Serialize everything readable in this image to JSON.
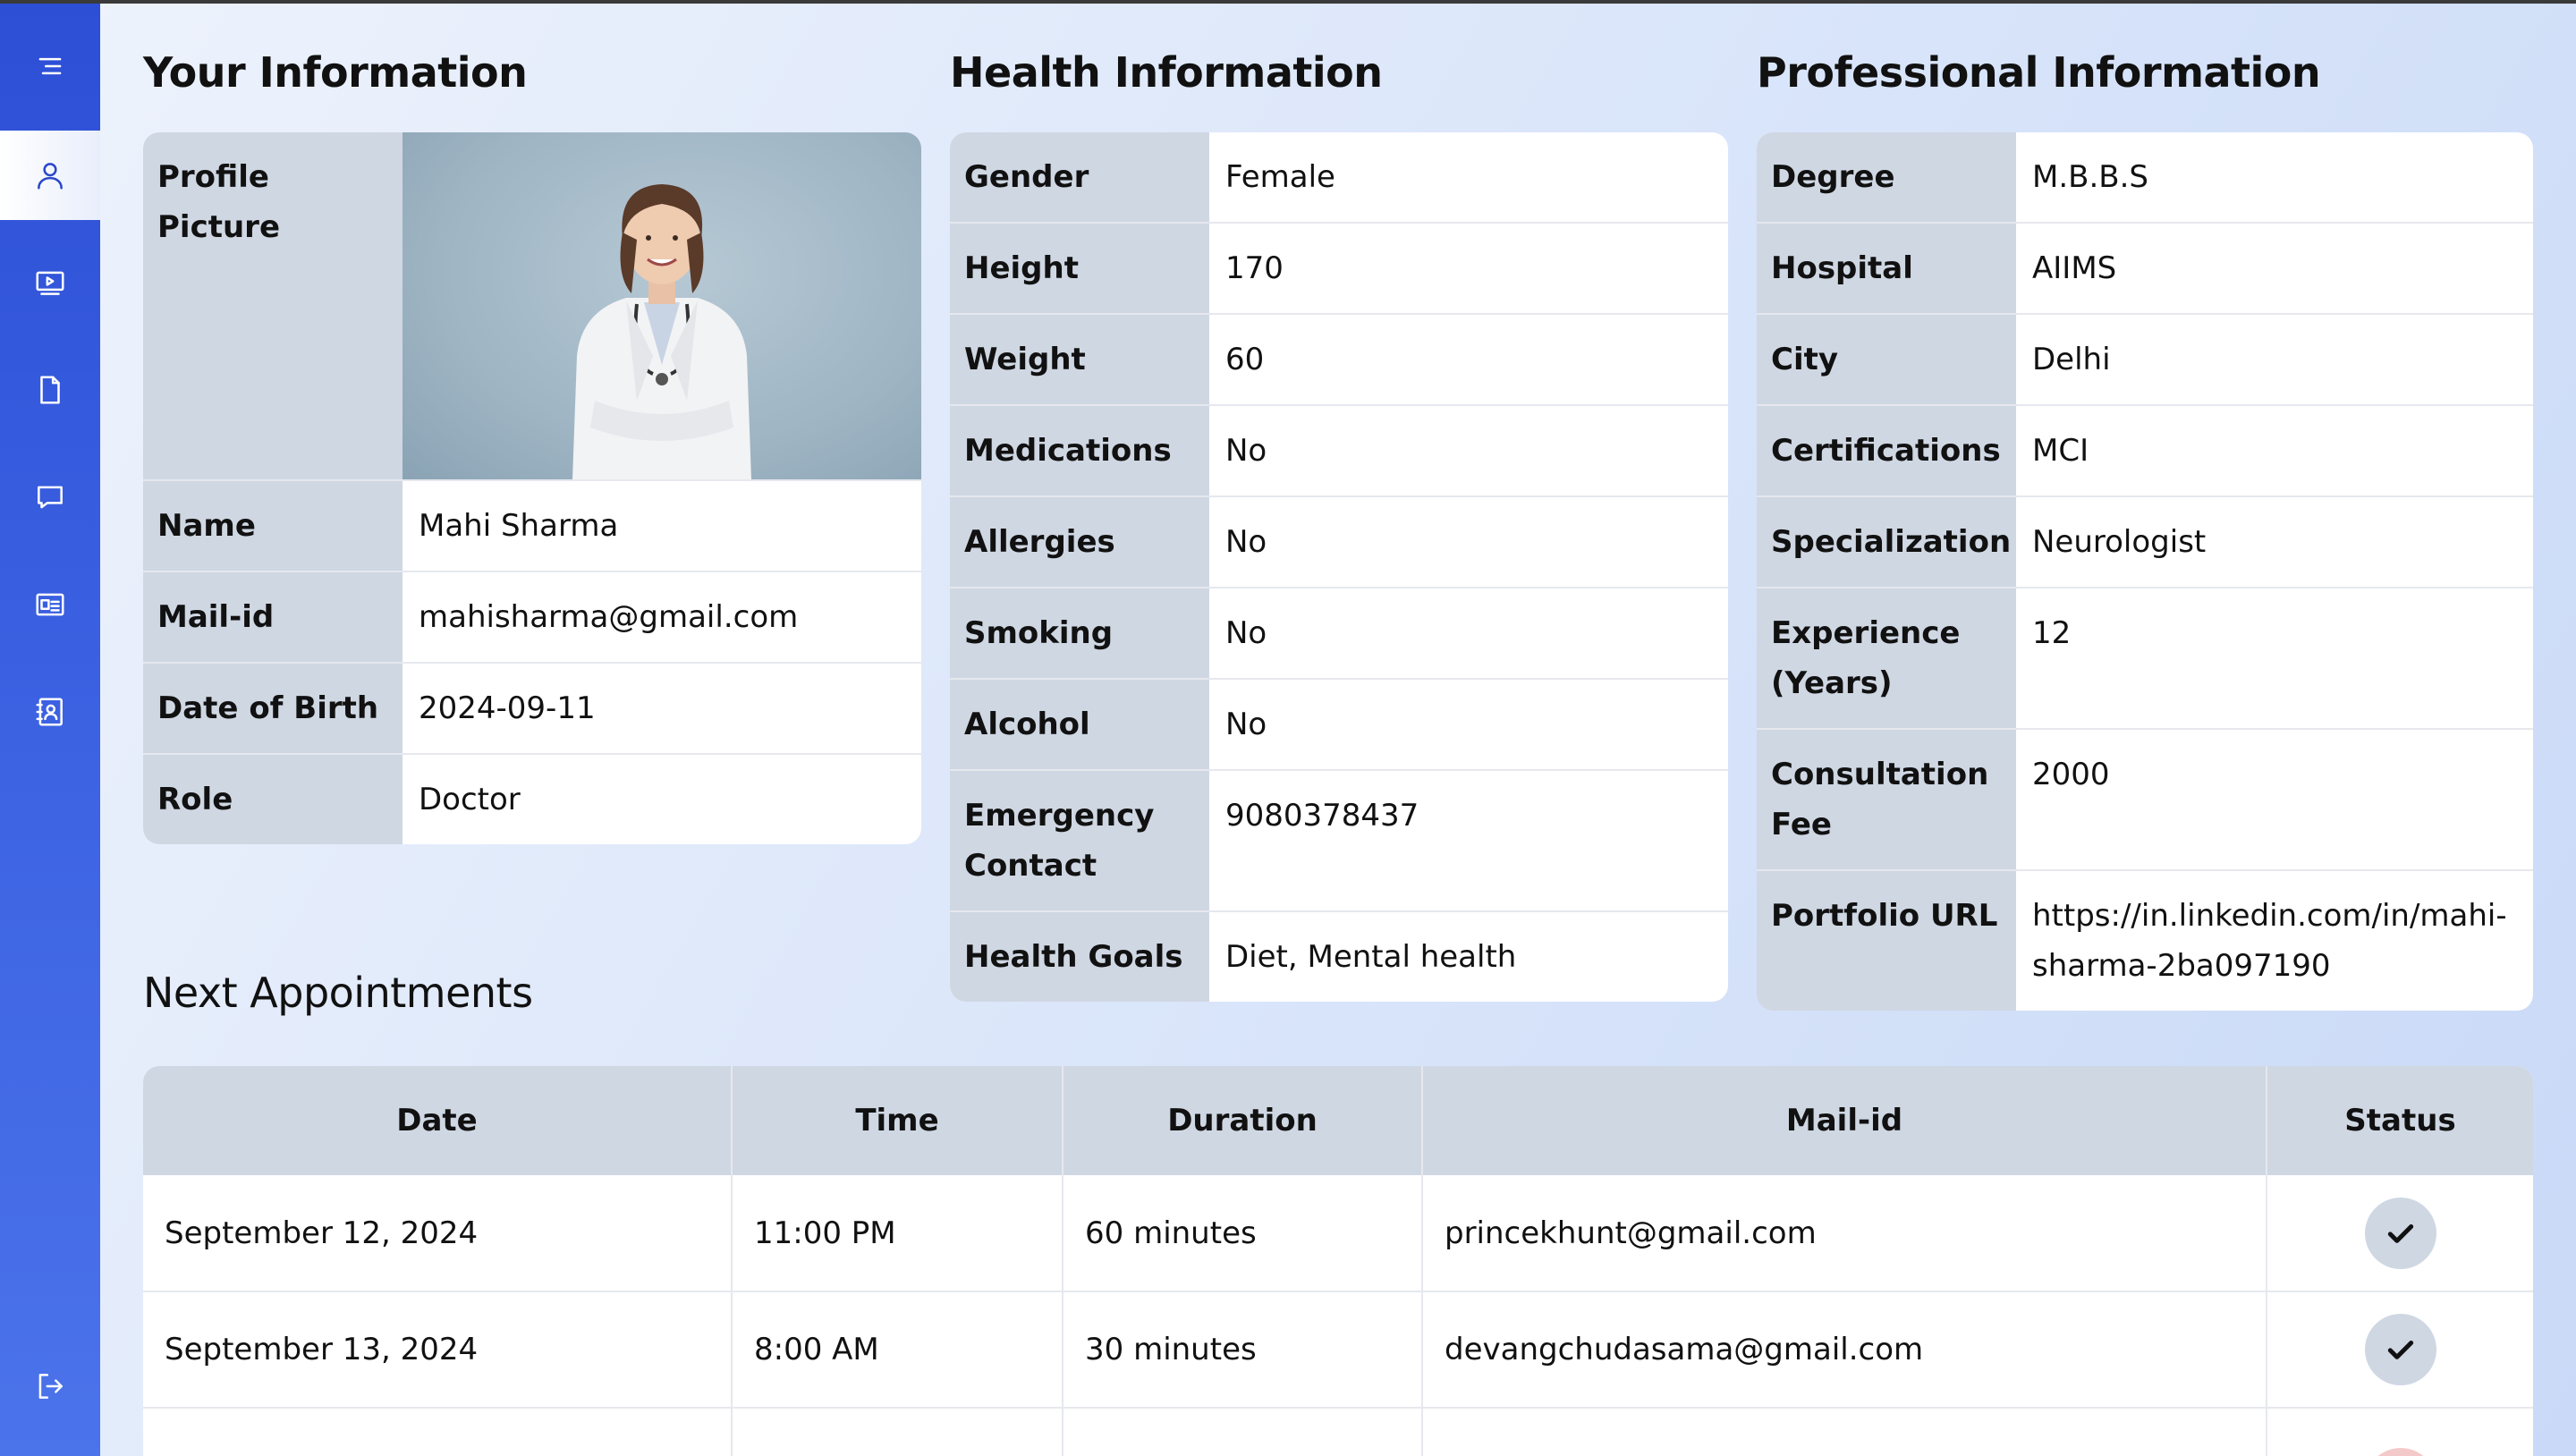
{
  "sidebar": {
    "items": [
      {
        "name": "menu",
        "icon": "menu-icon"
      },
      {
        "name": "profile",
        "icon": "user-icon",
        "active": true
      },
      {
        "name": "videos",
        "icon": "video-icon"
      },
      {
        "name": "documents",
        "icon": "document-icon"
      },
      {
        "name": "messages",
        "icon": "chat-icon"
      },
      {
        "name": "records",
        "icon": "id-card-icon"
      },
      {
        "name": "contacts",
        "icon": "contact-book-icon"
      },
      {
        "name": "logout",
        "icon": "logout-icon"
      }
    ]
  },
  "your_info": {
    "title": "Your Information",
    "picture_label": "Profile Picture",
    "rows": [
      {
        "label": "Name",
        "value": "Mahi Sharma"
      },
      {
        "label": "Mail-id",
        "value": "mahisharma@gmail.com"
      },
      {
        "label": "Date of Birth",
        "value": "2024-09-11"
      },
      {
        "label": "Role",
        "value": "Doctor"
      }
    ]
  },
  "health_info": {
    "title": "Health Information",
    "rows": [
      {
        "label": "Gender",
        "value": "Female"
      },
      {
        "label": "Height",
        "value": "170"
      },
      {
        "label": "Weight",
        "value": "60"
      },
      {
        "label": "Medications",
        "value": "No"
      },
      {
        "label": "Allergies",
        "value": "No"
      },
      {
        "label": "Smoking",
        "value": "No"
      },
      {
        "label": "Alcohol",
        "value": "No"
      },
      {
        "label": "Emergency Contact",
        "value": "9080378437"
      },
      {
        "label": "Health Goals",
        "value": "Diet, Mental health"
      }
    ]
  },
  "professional_info": {
    "title": "Professional Information",
    "rows": [
      {
        "label": "Degree",
        "value": "M.B.B.S"
      },
      {
        "label": "Hospital",
        "value": "AIIMS"
      },
      {
        "label": "City",
        "value": "Delhi"
      },
      {
        "label": "Certifications",
        "value": "MCI"
      },
      {
        "label": "Specialization",
        "value": "Neurologist"
      },
      {
        "label": "Experience (Years)",
        "value": "12"
      },
      {
        "label": "Consultation Fee",
        "value": "2000"
      },
      {
        "label": "Portfolio URL",
        "value": "https://in.linkedin.com/in/mahi-sharma-2ba097190"
      }
    ]
  },
  "appointments": {
    "title": "Next Appointments",
    "columns": [
      "Date",
      "Time",
      "Duration",
      "Mail-id",
      "Status"
    ],
    "rows": [
      {
        "date": "September 12, 2024",
        "time": "11:00 PM",
        "duration": "60 minutes",
        "mail": "princekhunt@gmail.com",
        "status": "confirmed"
      },
      {
        "date": "September 13, 2024",
        "time": "8:00 AM",
        "duration": "30 minutes",
        "mail": "devangchudasama@gmail.com",
        "status": "confirmed"
      }
    ]
  },
  "colors": {
    "sidebar": "#2d4fd6",
    "label_cell": "#cfd7e3",
    "status_done": "#cfd7e3",
    "status_pending": "#f4c9c9"
  }
}
